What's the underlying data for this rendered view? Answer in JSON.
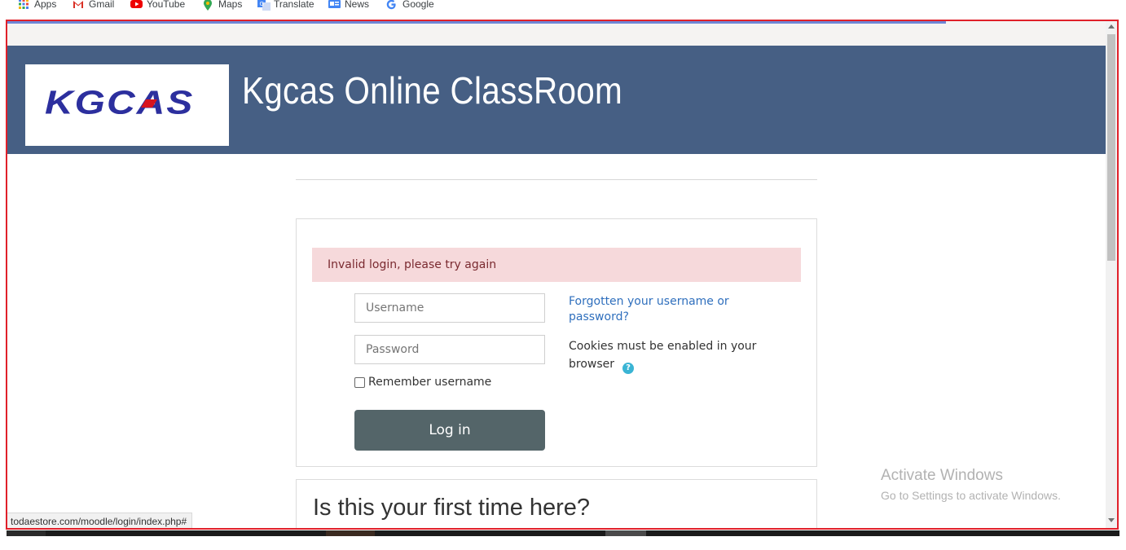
{
  "bookmarks": [
    {
      "label": "Apps",
      "icon": "apps-grid-icon"
    },
    {
      "label": "Gmail",
      "icon": "gmail-icon"
    },
    {
      "label": "YouTube",
      "icon": "youtube-icon"
    },
    {
      "label": "Maps",
      "icon": "maps-pin-icon"
    },
    {
      "label": "Translate",
      "icon": "translate-icon"
    },
    {
      "label": "News",
      "icon": "news-icon"
    },
    {
      "label": "Google",
      "icon": "google-g-icon"
    }
  ],
  "header": {
    "logo_text": "KGCAS",
    "site_title": "Kgcas Online ClassRoom"
  },
  "login": {
    "error_message": "Invalid login, please try again",
    "username_placeholder": "Username",
    "password_placeholder": "Password",
    "remember_label": "Remember username",
    "remember_checked": false,
    "login_button": "Log in",
    "forgot_link": "Forgotten your username or password?",
    "cookies_text": "Cookies must be enabled in your browser",
    "help_icon": "question-circle-icon"
  },
  "first_time": {
    "heading": "Is this your first time here?"
  },
  "watermark": {
    "title": "Activate Windows",
    "subtitle": "Go to Settings to activate Windows."
  },
  "status_bar": {
    "url": "todaestore.com/moodle/login/index.php#"
  },
  "colors": {
    "header_bg": "#465f84",
    "logo_blue": "#2c2f9e",
    "logo_red": "#d8141e",
    "alert_bg": "#f6d9db",
    "link": "#2f6fbd",
    "button_bg": "#546569",
    "frame_border": "#e0202a"
  }
}
